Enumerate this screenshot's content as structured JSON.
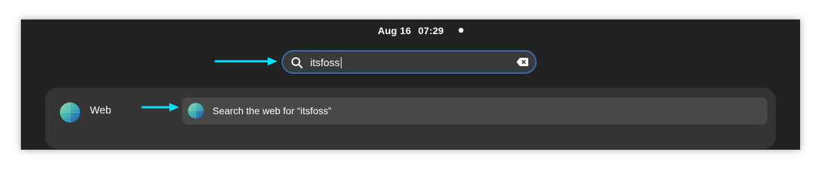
{
  "topbar": {
    "date": "Aug 16",
    "time": "07:29"
  },
  "search": {
    "value": "itsfoss",
    "icon": "search-icon",
    "clear_icon": "clear-text-icon"
  },
  "results": {
    "provider": {
      "label": "Web",
      "icon": "web-browser-globe-icon"
    },
    "items": [
      {
        "label": "Search the web for “itsfoss”",
        "icon": "web-browser-globe-icon"
      }
    ]
  },
  "annotations": {
    "arrow_color": "#00e5ff"
  },
  "colors": {
    "focus_border": "#3a6ea8",
    "background": "#222222"
  }
}
